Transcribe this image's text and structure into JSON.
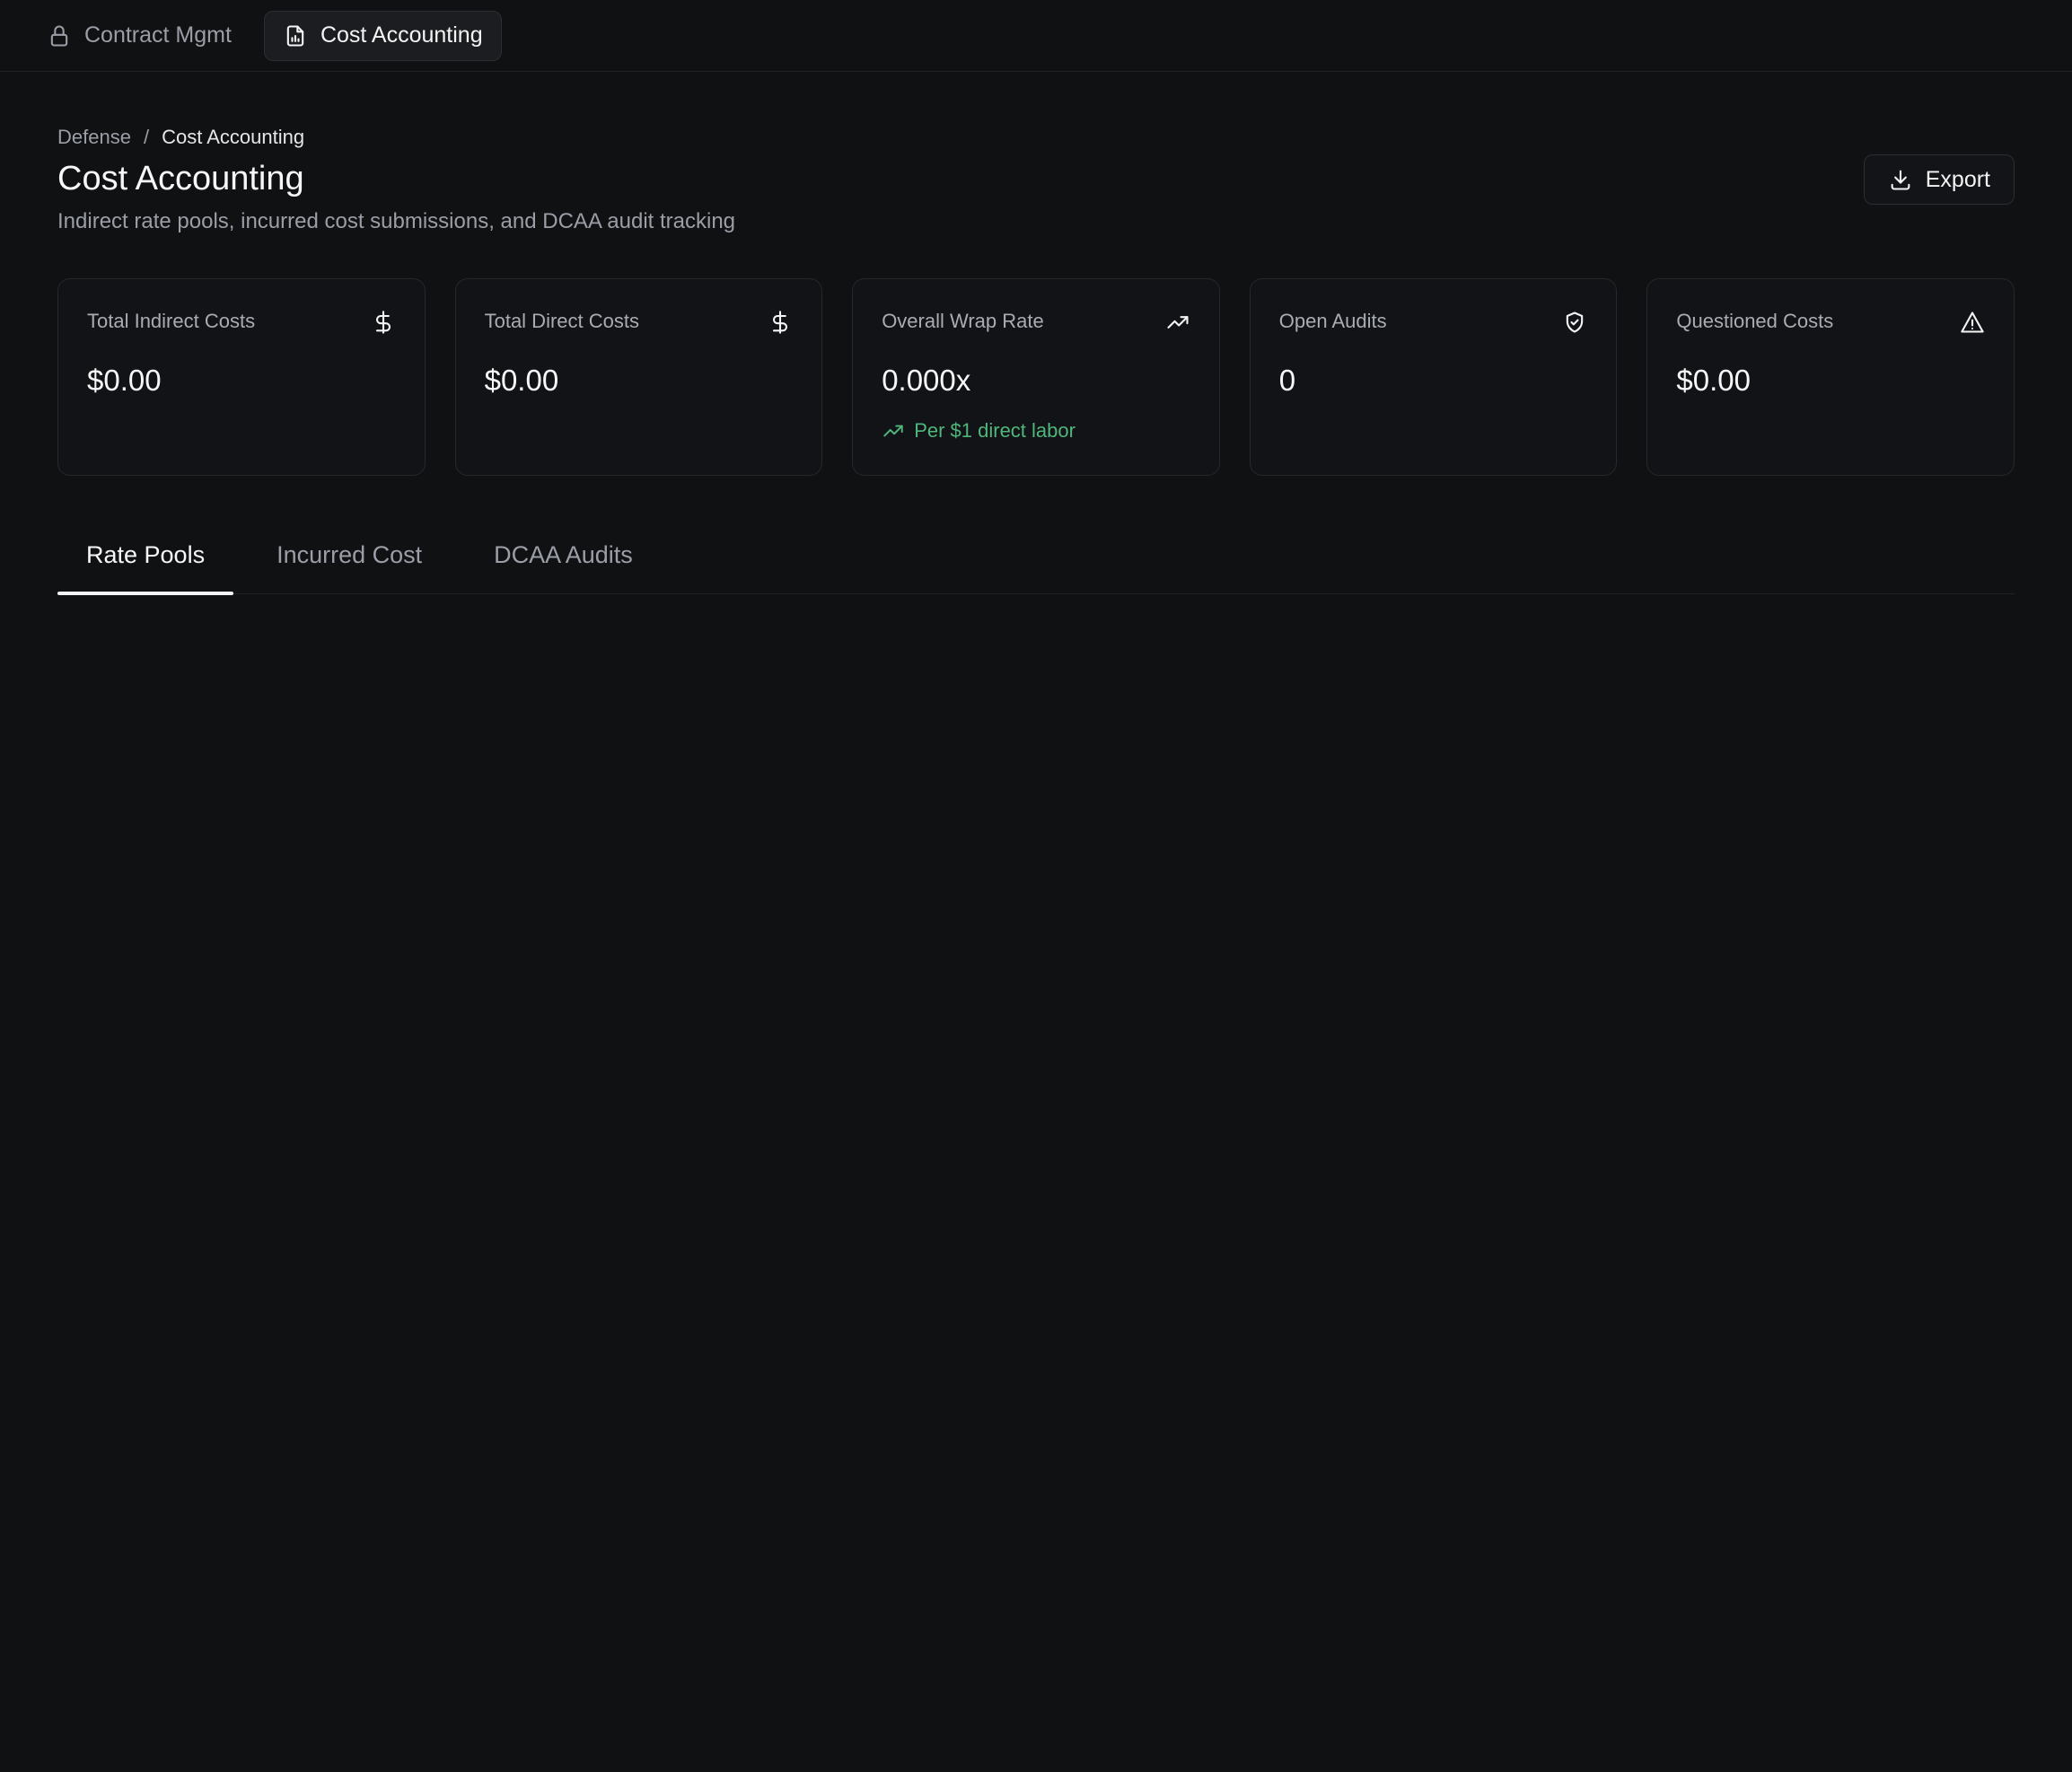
{
  "topbar": {
    "tabs": [
      {
        "label": "Contract Mgmt",
        "icon": "lock-icon",
        "active": false
      },
      {
        "label": "Cost Accounting",
        "icon": "document-chart-icon",
        "active": true
      }
    ]
  },
  "header": {
    "breadcrumb": [
      "Defense",
      "Cost Accounting"
    ],
    "breadcrumb_separator": "/",
    "title": "Cost Accounting",
    "subtitle": "Indirect rate pools, incurred cost submissions, and DCAA audit tracking",
    "export_label": "Export"
  },
  "cards": [
    {
      "label": "Total Indirect Costs",
      "value": "$0.00",
      "icon": "dollar-icon"
    },
    {
      "label": "Total Direct Costs",
      "value": "$0.00",
      "icon": "dollar-icon"
    },
    {
      "label": "Overall Wrap Rate",
      "value": "0.000x",
      "icon": "trending-up-icon",
      "note": "Per $1 direct labor"
    },
    {
      "label": "Open Audits",
      "value": "0",
      "icon": "shield-check-icon"
    },
    {
      "label": "Questioned Costs",
      "value": "$0.00",
      "icon": "warning-triangle-icon"
    }
  ],
  "tabs": [
    {
      "label": "Rate Pools",
      "active": true
    },
    {
      "label": "Incurred Cost",
      "active": false
    },
    {
      "label": "DCAA Audits",
      "active": false
    }
  ],
  "colors": {
    "background": "#0f1113",
    "accent_positive": "#4fb77b",
    "text_primary": "#f4f4f5",
    "text_muted": "#9b9ea6"
  }
}
